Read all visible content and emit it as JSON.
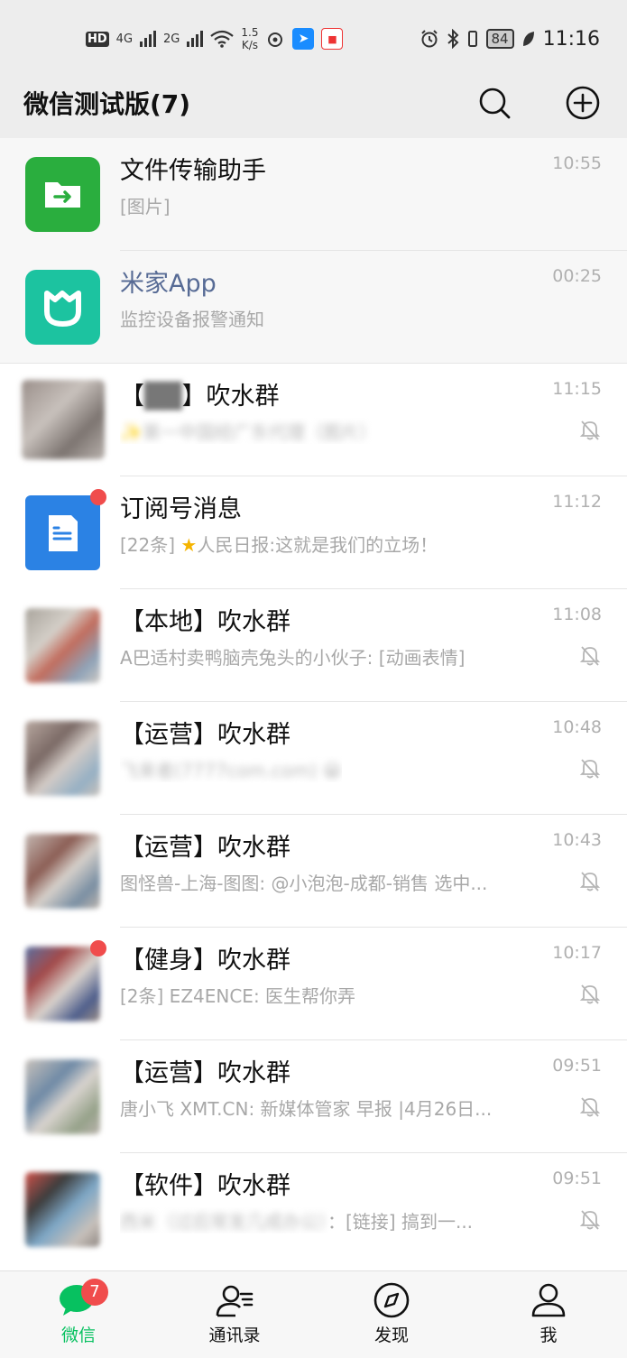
{
  "status_bar": {
    "hd_label": "HD",
    "sim1_label": "4G",
    "sim2_label": "2G",
    "speed_value": "1.5",
    "speed_unit": "K/s",
    "battery": "84",
    "time": "11:16"
  },
  "header": {
    "title": "微信测试版(7)",
    "search_icon": "search-icon",
    "add_icon": "plus-circle-icon"
  },
  "chats": [
    {
      "title": "文件传输助手",
      "subtitle": "[图片]",
      "time": "10:55",
      "pinned": true,
      "avatar": "file-transfer-icon",
      "avatar_color": "#2aae3e"
    },
    {
      "title": "米家App",
      "subtitle": "监控设备报警通知",
      "time": "00:25",
      "pinned": true,
      "avatar": "mijia-icon",
      "avatar_color": "#1cc3a0"
    },
    {
      "title_prefix": "【",
      "title_mid": "██",
      "title_suffix": "】吹水群",
      "subtitle": "✨第一中国经广东代理（图片）",
      "time": "11:15",
      "muted": true
    },
    {
      "title": "订阅号消息",
      "subtitle_prefix": "[22条] ",
      "subtitle": "人民日报:这就是我们的立场！",
      "time": "11:12",
      "unread_dot": true,
      "avatar": "subscription-icon",
      "avatar_color": "#2b82e4"
    },
    {
      "title": "【本地】吹水群",
      "subtitle": "A巴适村卖鸭脑壳兔头的小伙子: [动画表情]",
      "time": "11:08",
      "muted": true
    },
    {
      "title": "【运营】吹水群",
      "subtitle": "飞来者(7777com.com) 😀",
      "time": "10:48",
      "muted": true
    },
    {
      "title": "【运营】吹水群",
      "subtitle": "图怪兽-上海-图图: @小泡泡-成都-销售 选中...",
      "time": "10:43",
      "muted": true
    },
    {
      "title": "【健身】吹水群",
      "subtitle": "[2条] EZ4ENCE: 医生帮你弄",
      "time": "10:17",
      "muted": true,
      "unread_dot": true
    },
    {
      "title": "【运营】吹水群",
      "subtitle": "唐小飞 XMT.CN: 新媒体管家 早报 |4月26日...",
      "time": "09:51",
      "muted": true
    },
    {
      "title": "【软件】吹水群",
      "subtitle_blur": "西米（过后常发几成办公）",
      "subtitle": "：[链接] 搞到一...",
      "time": "09:51",
      "muted": true
    }
  ],
  "tabs": [
    {
      "label": "微信",
      "icon": "chat-bubble-icon",
      "badge": "7",
      "active": true
    },
    {
      "label": "通讯录",
      "icon": "contacts-icon"
    },
    {
      "label": "发现",
      "icon": "compass-icon"
    },
    {
      "label": "我",
      "icon": "person-icon"
    }
  ],
  "colors": {
    "accent": "#07c160",
    "badge": "#f04c4c",
    "header_bg": "#ededed",
    "link_title": "#576b95"
  }
}
